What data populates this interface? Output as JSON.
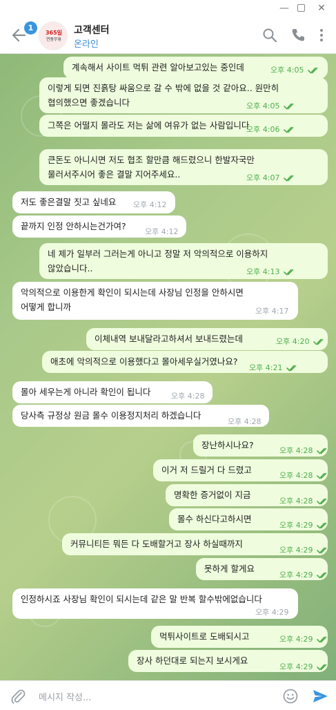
{
  "window": {
    "minimize": "—",
    "close": "✕"
  },
  "header": {
    "title": "고객센터",
    "status": "온라인",
    "unread_badge": "1",
    "avatar_text": "365일",
    "avatar_sub": "연중무휴",
    "accent": "#3a95de"
  },
  "messages": [
    {
      "dir": "out",
      "lines": [
        "계속해서 사이트 먹튀 관련 알아보고있는 중인데"
      ],
      "time": "오후 4:05",
      "read": true
    },
    {
      "dir": "out",
      "lines": [
        "이렇게 되면 진흙탕 싸움으로 갈 수 밖에 없을 것 같아요.. 원만히",
        "협의했으면 좋겠습니다"
      ],
      "time": "오후 4:05",
      "read": true
    },
    {
      "dir": "out",
      "lines": [
        "그쪽은 어떨지 몰라도 저는 삶에 여유가 없는 사람입니다"
      ],
      "time": "오후 4:06",
      "read": true
    },
    {
      "dir": "out",
      "lines": [
        "큰돈도 아니시면 저도 협조 할만큼 해드렸으니 한발자국만",
        "물러서주시어 좋은 결말 지어주세요.."
      ],
      "time": "오후 4:07",
      "read": true
    },
    {
      "dir": "in",
      "lines": [
        "저도 좋은결말 짓고 싶네요"
      ],
      "time": "오후 4:12"
    },
    {
      "dir": "in",
      "lines": [
        "끝까지 인정 안하시는건가여?"
      ],
      "time": "오후 4:12"
    },
    {
      "dir": "out",
      "lines": [
        "네 제가 일부러 그러는게 아니고 정말 저 악의적으로 이용하지",
        "않았습니다.."
      ],
      "time": "오후 4:13",
      "read": true
    },
    {
      "dir": "in",
      "lines": [
        "악의적으로 이용한게 확인이 되시는데 사장님 인정을 안하시면",
        "어떻게 합니까"
      ],
      "time": "오후 4:17"
    },
    {
      "dir": "out",
      "lines": [
        "이체내역 보내달라고하셔서 보내드렸는데"
      ],
      "time": "오후 4:20",
      "read": true
    },
    {
      "dir": "out",
      "lines": [
        "애초에 악의적으로 이용했다고 몰아세우실거였나요?"
      ],
      "time": "오후 4:21",
      "read": true
    },
    {
      "dir": "in",
      "lines": [
        "몰아 세우는게 아니라 확인이 됩니다"
      ],
      "time": "오후 4:28"
    },
    {
      "dir": "in",
      "lines": [
        "당사측 규정상 원금 몰수 이용정지처리 하겠습니다"
      ],
      "time": "오후 4:28"
    },
    {
      "dir": "out",
      "lines": [
        "장난하시나요?"
      ],
      "time": "오후 4:28",
      "read": true
    },
    {
      "dir": "out",
      "lines": [
        "이거 저 드릴거 다 드렸고"
      ],
      "time": "오후 4:28",
      "read": true
    },
    {
      "dir": "out",
      "lines": [
        "명확한 증거없이 지금"
      ],
      "time": "오후 4:28",
      "read": true
    },
    {
      "dir": "out",
      "lines": [
        "몰수 하신다고하시면"
      ],
      "time": "오후 4:29",
      "read": true
    },
    {
      "dir": "out",
      "lines": [
        "커뮤니티든 뭐든 다 도배할거고 장사 하실때까지"
      ],
      "time": "오후 4:29",
      "read": true
    },
    {
      "dir": "out",
      "lines": [
        "못하게 할게요"
      ],
      "time": "오후 4:29",
      "read": true
    },
    {
      "dir": "in",
      "lines": [
        "인정하시죠 사장님 확인이 되시는데 같은 말 반복 할수밖에없습니다"
      ],
      "time": "오후 4:29"
    },
    {
      "dir": "out",
      "lines": [
        "먹튀사이트로 도배되시고"
      ],
      "time": "오후 4:29",
      "read": true
    },
    {
      "dir": "out",
      "lines": [
        "장사 하던대로 되는지 보시게요"
      ],
      "time": "오후 4:29",
      "read": true
    }
  ],
  "composer": {
    "placeholder": "메시지 작성..."
  },
  "colors": {
    "outgoing_bubble": "#effdde",
    "incoming_bubble": "#ffffff",
    "read_ticks": "#4fae4e",
    "background": "#a8c98a"
  }
}
